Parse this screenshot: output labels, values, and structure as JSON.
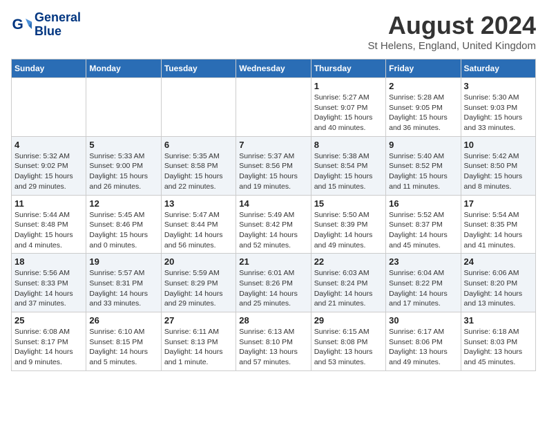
{
  "header": {
    "logo_line1": "General",
    "logo_line2": "Blue",
    "month_year": "August 2024",
    "location": "St Helens, England, United Kingdom"
  },
  "weekdays": [
    "Sunday",
    "Monday",
    "Tuesday",
    "Wednesday",
    "Thursday",
    "Friday",
    "Saturday"
  ],
  "weeks": [
    [
      {
        "day": "",
        "info": ""
      },
      {
        "day": "",
        "info": ""
      },
      {
        "day": "",
        "info": ""
      },
      {
        "day": "",
        "info": ""
      },
      {
        "day": "1",
        "info": "Sunrise: 5:27 AM\nSunset: 9:07 PM\nDaylight: 15 hours\nand 40 minutes."
      },
      {
        "day": "2",
        "info": "Sunrise: 5:28 AM\nSunset: 9:05 PM\nDaylight: 15 hours\nand 36 minutes."
      },
      {
        "day": "3",
        "info": "Sunrise: 5:30 AM\nSunset: 9:03 PM\nDaylight: 15 hours\nand 33 minutes."
      }
    ],
    [
      {
        "day": "4",
        "info": "Sunrise: 5:32 AM\nSunset: 9:02 PM\nDaylight: 15 hours\nand 29 minutes."
      },
      {
        "day": "5",
        "info": "Sunrise: 5:33 AM\nSunset: 9:00 PM\nDaylight: 15 hours\nand 26 minutes."
      },
      {
        "day": "6",
        "info": "Sunrise: 5:35 AM\nSunset: 8:58 PM\nDaylight: 15 hours\nand 22 minutes."
      },
      {
        "day": "7",
        "info": "Sunrise: 5:37 AM\nSunset: 8:56 PM\nDaylight: 15 hours\nand 19 minutes."
      },
      {
        "day": "8",
        "info": "Sunrise: 5:38 AM\nSunset: 8:54 PM\nDaylight: 15 hours\nand 15 minutes."
      },
      {
        "day": "9",
        "info": "Sunrise: 5:40 AM\nSunset: 8:52 PM\nDaylight: 15 hours\nand 11 minutes."
      },
      {
        "day": "10",
        "info": "Sunrise: 5:42 AM\nSunset: 8:50 PM\nDaylight: 15 hours\nand 8 minutes."
      }
    ],
    [
      {
        "day": "11",
        "info": "Sunrise: 5:44 AM\nSunset: 8:48 PM\nDaylight: 15 hours\nand 4 minutes."
      },
      {
        "day": "12",
        "info": "Sunrise: 5:45 AM\nSunset: 8:46 PM\nDaylight: 15 hours\nand 0 minutes."
      },
      {
        "day": "13",
        "info": "Sunrise: 5:47 AM\nSunset: 8:44 PM\nDaylight: 14 hours\nand 56 minutes."
      },
      {
        "day": "14",
        "info": "Sunrise: 5:49 AM\nSunset: 8:42 PM\nDaylight: 14 hours\nand 52 minutes."
      },
      {
        "day": "15",
        "info": "Sunrise: 5:50 AM\nSunset: 8:39 PM\nDaylight: 14 hours\nand 49 minutes."
      },
      {
        "day": "16",
        "info": "Sunrise: 5:52 AM\nSunset: 8:37 PM\nDaylight: 14 hours\nand 45 minutes."
      },
      {
        "day": "17",
        "info": "Sunrise: 5:54 AM\nSunset: 8:35 PM\nDaylight: 14 hours\nand 41 minutes."
      }
    ],
    [
      {
        "day": "18",
        "info": "Sunrise: 5:56 AM\nSunset: 8:33 PM\nDaylight: 14 hours\nand 37 minutes."
      },
      {
        "day": "19",
        "info": "Sunrise: 5:57 AM\nSunset: 8:31 PM\nDaylight: 14 hours\nand 33 minutes."
      },
      {
        "day": "20",
        "info": "Sunrise: 5:59 AM\nSunset: 8:29 PM\nDaylight: 14 hours\nand 29 minutes."
      },
      {
        "day": "21",
        "info": "Sunrise: 6:01 AM\nSunset: 8:26 PM\nDaylight: 14 hours\nand 25 minutes."
      },
      {
        "day": "22",
        "info": "Sunrise: 6:03 AM\nSunset: 8:24 PM\nDaylight: 14 hours\nand 21 minutes."
      },
      {
        "day": "23",
        "info": "Sunrise: 6:04 AM\nSunset: 8:22 PM\nDaylight: 14 hours\nand 17 minutes."
      },
      {
        "day": "24",
        "info": "Sunrise: 6:06 AM\nSunset: 8:20 PM\nDaylight: 14 hours\nand 13 minutes."
      }
    ],
    [
      {
        "day": "25",
        "info": "Sunrise: 6:08 AM\nSunset: 8:17 PM\nDaylight: 14 hours\nand 9 minutes."
      },
      {
        "day": "26",
        "info": "Sunrise: 6:10 AM\nSunset: 8:15 PM\nDaylight: 14 hours\nand 5 minutes."
      },
      {
        "day": "27",
        "info": "Sunrise: 6:11 AM\nSunset: 8:13 PM\nDaylight: 14 hours\nand 1 minute."
      },
      {
        "day": "28",
        "info": "Sunrise: 6:13 AM\nSunset: 8:10 PM\nDaylight: 13 hours\nand 57 minutes."
      },
      {
        "day": "29",
        "info": "Sunrise: 6:15 AM\nSunset: 8:08 PM\nDaylight: 13 hours\nand 53 minutes."
      },
      {
        "day": "30",
        "info": "Sunrise: 6:17 AM\nSunset: 8:06 PM\nDaylight: 13 hours\nand 49 minutes."
      },
      {
        "day": "31",
        "info": "Sunrise: 6:18 AM\nSunset: 8:03 PM\nDaylight: 13 hours\nand 45 minutes."
      }
    ]
  ]
}
